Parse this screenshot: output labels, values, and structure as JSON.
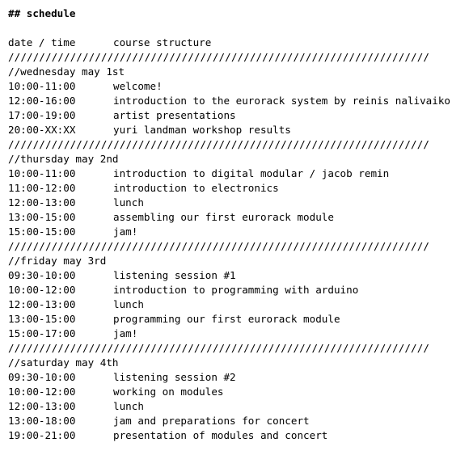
{
  "heading": "## schedule",
  "columns": {
    "time": "date / time",
    "desc": "course structure"
  },
  "separator": "////////////////////////////////////////////////////////////////////",
  "days": [
    {
      "label": "//wednesday may 1st",
      "rows": [
        {
          "time": "10:00-11:00",
          "desc": "welcome!"
        },
        {
          "time": "12:00-16:00",
          "desc": "introduction to the eurorack system by reinis nalivaiko"
        },
        {
          "time": "17:00-19:00",
          "desc": "artist presentations"
        },
        {
          "time": "20:00-XX:XX",
          "desc": "yuri landman workshop results"
        }
      ]
    },
    {
      "label": "//thursday may 2nd",
      "rows": [
        {
          "time": "10:00-11:00",
          "desc": "introduction to digital modular / jacob remin"
        },
        {
          "time": "11:00-12:00",
          "desc": "introduction to electronics"
        },
        {
          "time": "12:00-13:00",
          "desc": "lunch"
        },
        {
          "time": "13:00-15:00",
          "desc": "assembling our first eurorack module"
        },
        {
          "time": "15:00-15:00",
          "desc": "jam!"
        }
      ]
    },
    {
      "label": "//friday may 3rd",
      "rows": [
        {
          "time": "09:30-10:00",
          "desc": "listening session #1"
        },
        {
          "time": "10:00-12:00",
          "desc": "introduction to programming with arduino"
        },
        {
          "time": "12:00-13:00",
          "desc": "lunch"
        },
        {
          "time": "13:00-15:00",
          "desc": "programming our first eurorack module"
        },
        {
          "time": "15:00-17:00",
          "desc": "jam!"
        }
      ]
    },
    {
      "label": "//saturday may 4th",
      "rows": [
        {
          "time": "09:30-10:00",
          "desc": "listening session #2"
        },
        {
          "time": "10:00-12:00",
          "desc": "working on modules"
        },
        {
          "time": "12:00-13:00",
          "desc": "lunch"
        },
        {
          "time": "13:00-18:00",
          "desc": "jam and preparations for concert"
        },
        {
          "time": "19:00-21:00",
          "desc": "presentation of modules and concert"
        }
      ]
    }
  ]
}
